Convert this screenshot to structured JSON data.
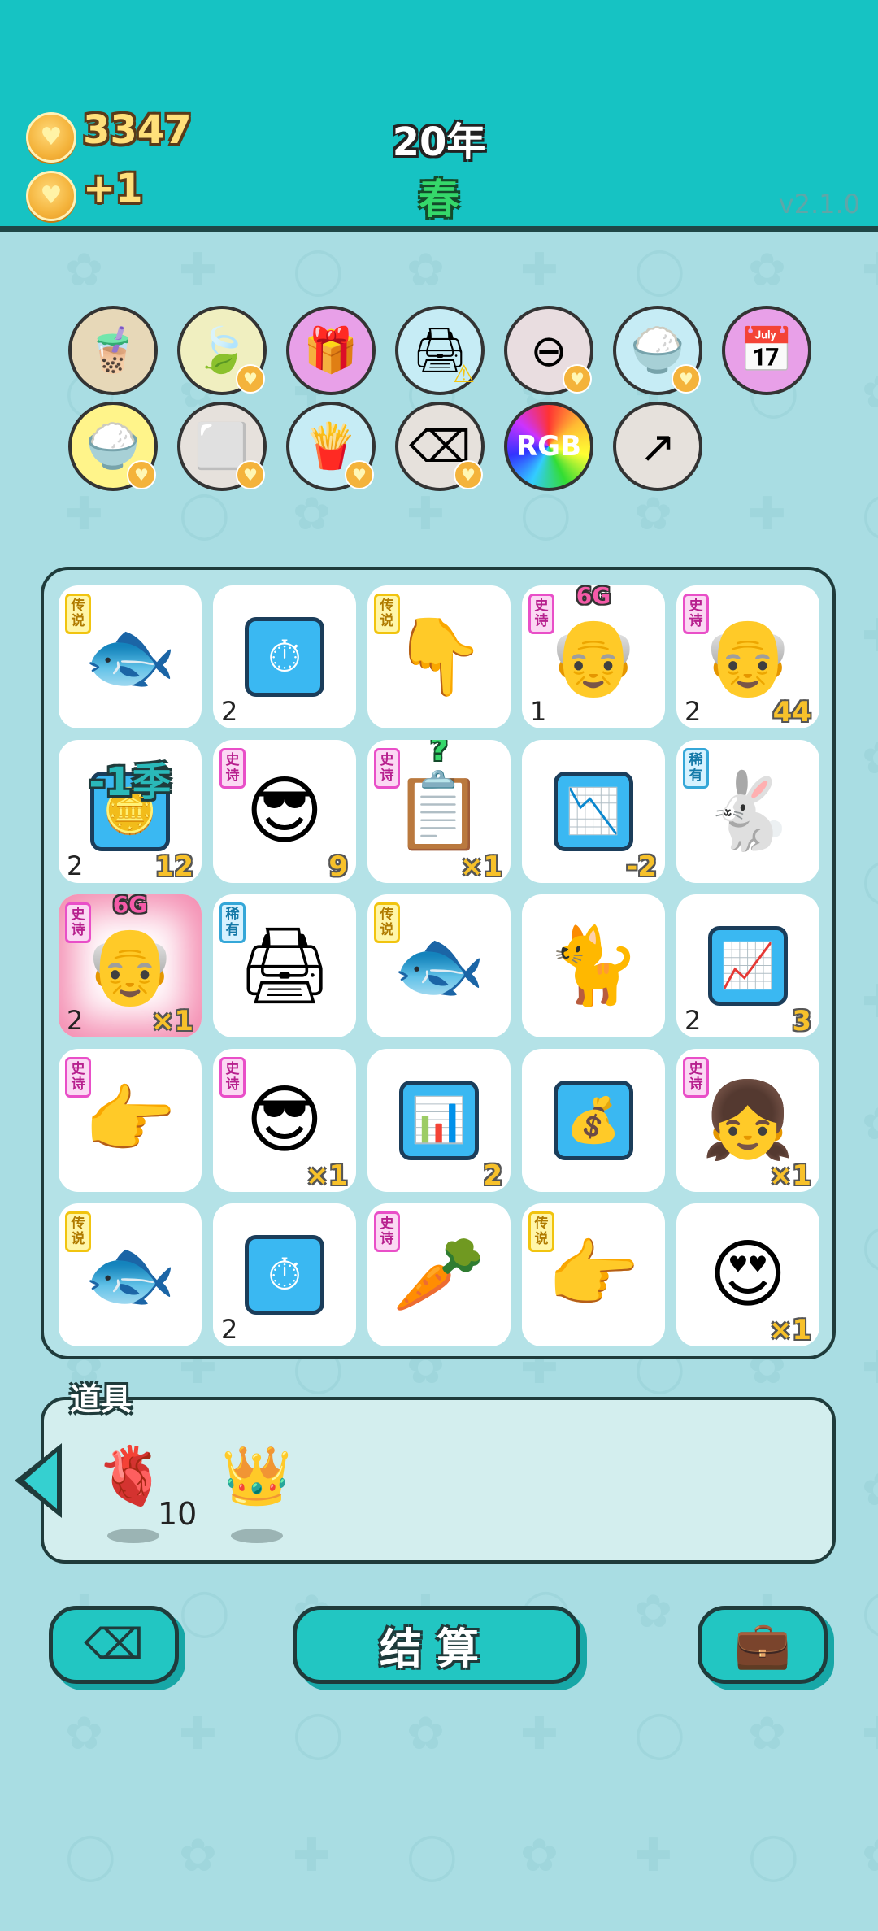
{
  "header": {
    "coins": "3347",
    "income": "+1",
    "year": "20年",
    "season": "春",
    "version": "v2.1.0"
  },
  "relics": [
    {
      "name": "bubble-tea-relic",
      "glyph": "🧋",
      "bg": "#e7d8b8",
      "heart": false
    },
    {
      "name": "leaf-relic",
      "glyph": "🍃",
      "bg": "#f0efc0",
      "heart": true
    },
    {
      "name": "gift-box-relic",
      "glyph": "🎁",
      "bg": "#e8a0e8",
      "heart": false
    },
    {
      "name": "printer-relic",
      "glyph": "🖨",
      "bg": "#c6ecf5",
      "heart": false,
      "warn": true
    },
    {
      "name": "minus-relic",
      "glyph": "⊖",
      "bg": "#e9dde0",
      "heart": true
    },
    {
      "name": "rice-bowl-relic",
      "glyph": "🍚",
      "bg": "#c6ecf5",
      "heart": true
    },
    {
      "name": "calendar-relic",
      "glyph": "📅",
      "bg": "#e8a0e8",
      "heart": false
    },
    {
      "name": "rice-bowl-gold-relic",
      "glyph": "🍚",
      "bg": "#fff48a",
      "heart": true
    },
    {
      "name": "sugar-cubes-relic",
      "glyph": "⬜",
      "bg": "#e6e1dc",
      "heart": true
    },
    {
      "name": "fries-relic",
      "glyph": "🍟",
      "bg": "#c6ecf5",
      "heart": true
    },
    {
      "name": "delete-key-relic",
      "glyph": "⌫",
      "bg": "#e6e1dc",
      "heart": true
    },
    {
      "name": "rgb-relic",
      "glyph": "RGB",
      "bg": "rainbow",
      "heart": false
    },
    {
      "name": "share-arrow-relic",
      "glyph": "↗",
      "bg": "#e6e1dc",
      "heart": false
    }
  ],
  "rarity_labels": {
    "legend": "传说",
    "epic": "史诗",
    "rare": "稀有"
  },
  "board": [
    [
      {
        "name": "koi-fish",
        "glyph": "🐟",
        "rarity": "legend",
        "count": "",
        "value": ""
      },
      {
        "name": "stopwatch",
        "glyph": "⏱",
        "rarity": "",
        "count": "2",
        "value": "",
        "box": true
      },
      {
        "name": "pointing-down-hand",
        "glyph": "👇",
        "rarity": "legend",
        "count": "",
        "value": ""
      },
      {
        "name": "grandpa-heart-eyes",
        "glyph": "👴",
        "rarity": "epic",
        "count": "1",
        "value": "",
        "top": "6G"
      },
      {
        "name": "grandpa",
        "glyph": "👴",
        "rarity": "epic",
        "count": "2",
        "value": "44"
      }
    ],
    [
      {
        "name": "gold-bars",
        "glyph": "🪙",
        "rarity": "",
        "count": "2",
        "value": "12",
        "over": "-1季",
        "box": true
      },
      {
        "name": "green-cap-guy",
        "glyph": "😎",
        "rarity": "epic",
        "count": "",
        "value": "9"
      },
      {
        "name": "ctrl-c-ctrl-v",
        "glyph": "📋",
        "rarity": "epic",
        "count": "",
        "value": "×1",
        "q": "?"
      },
      {
        "name": "falling-chart",
        "glyph": "📉",
        "rarity": "",
        "count": "",
        "value": "-2",
        "box": true
      },
      {
        "name": "rabbit",
        "glyph": "🐇",
        "rarity": "rare",
        "count": "",
        "value": ""
      }
    ],
    [
      {
        "name": "grandpa-glowing",
        "glyph": "👴",
        "rarity": "epic",
        "count": "2",
        "value": "×1",
        "top": "6G",
        "glow": true
      },
      {
        "name": "printer",
        "glyph": "🖨",
        "rarity": "rare",
        "count": "",
        "value": ""
      },
      {
        "name": "koi-fish",
        "glyph": "🐟",
        "rarity": "legend",
        "count": "",
        "value": ""
      },
      {
        "name": "cat",
        "glyph": "🐈",
        "rarity": "",
        "count": "",
        "value": ""
      },
      {
        "name": "trend-chart",
        "glyph": "📈",
        "rarity": "",
        "count": "2",
        "value": "3",
        "box": true
      }
    ],
    [
      {
        "name": "pointing-right-hand-gray",
        "glyph": "👉",
        "rarity": "epic",
        "count": "",
        "value": ""
      },
      {
        "name": "green-cap-guy",
        "glyph": "😎",
        "rarity": "epic",
        "count": "",
        "value": "×1"
      },
      {
        "name": "rising-chart",
        "glyph": "📊",
        "rarity": "",
        "count": "",
        "value": "2",
        "box": true
      },
      {
        "name": "gold-bars-coins",
        "glyph": "💰",
        "rarity": "",
        "count": "",
        "value": "",
        "box": true
      },
      {
        "name": "girl-with-heart",
        "glyph": "👧",
        "rarity": "epic",
        "count": "",
        "value": "×1"
      }
    ],
    [
      {
        "name": "koi-fish",
        "glyph": "🐟",
        "rarity": "legend",
        "count": "",
        "value": ""
      },
      {
        "name": "stopwatch",
        "glyph": "⏱",
        "rarity": "",
        "count": "2",
        "value": "",
        "box": true
      },
      {
        "name": "carrot",
        "glyph": "🥕",
        "rarity": "epic",
        "count": "",
        "value": ""
      },
      {
        "name": "pointing-right-hand",
        "glyph": "👉",
        "rarity": "legend",
        "count": "",
        "value": ""
      },
      {
        "name": "heart-eyes-guy",
        "glyph": "😍",
        "rarity": "",
        "count": "",
        "value": "×1"
      }
    ]
  ],
  "items": {
    "title": "道具",
    "list": [
      {
        "name": "liver-item",
        "glyph": "🫀",
        "count": "10"
      },
      {
        "name": "crown-item",
        "glyph": "👑",
        "count": ""
      }
    ]
  },
  "buttons": {
    "delete_glyph": "⌫",
    "settle_label": "结算",
    "bag_glyph": "💼"
  }
}
